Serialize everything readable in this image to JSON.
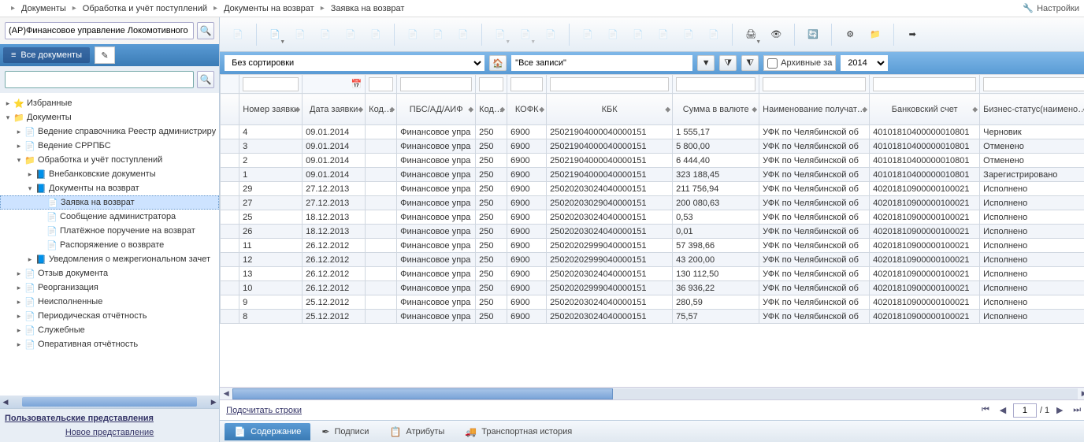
{
  "breadcrumb": {
    "items": [
      "Документы",
      "Обработка и учёт поступлений",
      "Документы на возврат",
      "Заявка на возврат"
    ]
  },
  "settings_label": "Настройки",
  "left": {
    "org_value": "(АР)Финансовое управление Локомотивного горо",
    "all_docs_tab": "Все документы",
    "tree": [
      {
        "d": 0,
        "t": "▸",
        "i": "⭐",
        "l": "Избранные"
      },
      {
        "d": 0,
        "t": "▾",
        "i": "📁",
        "l": "Документы"
      },
      {
        "d": 1,
        "t": "▸",
        "i": "📄",
        "l": "Ведение справочника Реестр администриру"
      },
      {
        "d": 1,
        "t": "▸",
        "i": "📄",
        "l": "Ведение СРРПБС"
      },
      {
        "d": 1,
        "t": "▾",
        "i": "📁",
        "l": "Обработка и учёт поступлений"
      },
      {
        "d": 2,
        "t": "▸",
        "i": "📘",
        "l": "Внебанковские документы"
      },
      {
        "d": 2,
        "t": "▾",
        "i": "📘",
        "l": "Документы на возврат"
      },
      {
        "d": 3,
        "t": "",
        "i": "📄",
        "l": "Заявка на возврат",
        "sel": true
      },
      {
        "d": 3,
        "t": "",
        "i": "📄",
        "l": "Сообщение администратора"
      },
      {
        "d": 3,
        "t": "",
        "i": "📄",
        "l": "Платёжное поручение на возврат"
      },
      {
        "d": 3,
        "t": "",
        "i": "📄",
        "l": "Распоряжение о возврате"
      },
      {
        "d": 2,
        "t": "▸",
        "i": "📘",
        "l": "Уведомления о межрегиональном зачет"
      },
      {
        "d": 1,
        "t": "▸",
        "i": "📄",
        "l": "Отзыв документа"
      },
      {
        "d": 1,
        "t": "▸",
        "i": "📄",
        "l": "Реорганизация"
      },
      {
        "d": 1,
        "t": "▸",
        "i": "📄",
        "l": "Неисполненные"
      },
      {
        "d": 1,
        "t": "▸",
        "i": "📄",
        "l": "Периодическая отчётность"
      },
      {
        "d": 1,
        "t": "▸",
        "i": "📄",
        "l": "Служебные"
      },
      {
        "d": 1,
        "t": "▸",
        "i": "📄",
        "l": "Оперативная отчётность"
      }
    ],
    "user_views_title": "Пользовательские представления",
    "new_view_link": "Новое представление"
  },
  "filterbar": {
    "sort_value": "Без сортировки",
    "records_value": "\"Все записи\"",
    "archive_label": "Архивные за",
    "archive_year": "2014"
  },
  "grid": {
    "columns": [
      {
        "k": "num",
        "label": "Номер заявки"
      },
      {
        "k": "date",
        "label": "Дата заявки"
      },
      {
        "k": "kod1",
        "label": "Код по Свод реест"
      },
      {
        "k": "pbs",
        "label": "ПБС/АД/АИФ"
      },
      {
        "k": "kod2",
        "label": "Код главы по БК"
      },
      {
        "k": "kofk",
        "label": "КОФК"
      },
      {
        "k": "kbk",
        "label": "КБК"
      },
      {
        "k": "sum",
        "label": "Сумма в валюте"
      },
      {
        "k": "recv",
        "label": "Наименование получателя"
      },
      {
        "k": "acc",
        "label": "Банковский счет"
      },
      {
        "k": "stat",
        "label": "Бизнес-статус(наименован"
      }
    ],
    "rows": [
      {
        "num": "4",
        "date": "09.01.2014",
        "kod1": "",
        "pbs": "Финансовое упра",
        "kod2": "250",
        "kofk": "6900",
        "kbk": "25021904000040000151",
        "sum": "1 555,17",
        "recv": "УФК по Челябинской об",
        "acc": "40101810400000010801",
        "stat": "Черновик"
      },
      {
        "num": "3",
        "date": "09.01.2014",
        "kod1": "",
        "pbs": "Финансовое упра",
        "kod2": "250",
        "kofk": "6900",
        "kbk": "25021904000040000151",
        "sum": "5 800,00",
        "recv": "УФК по Челябинской об",
        "acc": "40101810400000010801",
        "stat": "Отменено"
      },
      {
        "num": "2",
        "date": "09.01.2014",
        "kod1": "",
        "pbs": "Финансовое упра",
        "kod2": "250",
        "kofk": "6900",
        "kbk": "25021904000040000151",
        "sum": "6 444,40",
        "recv": "УФК по Челябинской об",
        "acc": "40101810400000010801",
        "stat": "Отменено"
      },
      {
        "num": "1",
        "date": "09.01.2014",
        "kod1": "",
        "pbs": "Финансовое упра",
        "kod2": "250",
        "kofk": "6900",
        "kbk": "25021904000040000151",
        "sum": "323 188,45",
        "recv": "УФК по Челябинской об",
        "acc": "40101810400000010801",
        "stat": "Зарегистрировано"
      },
      {
        "num": "29",
        "date": "27.12.2013",
        "kod1": "",
        "pbs": "Финансовое упра",
        "kod2": "250",
        "kofk": "6900",
        "kbk": "25020203024040000151",
        "sum": "211 756,94",
        "recv": "УФК по Челябинской об",
        "acc": "40201810900000100021",
        "stat": "Исполнено"
      },
      {
        "num": "27",
        "date": "27.12.2013",
        "kod1": "",
        "pbs": "Финансовое упра",
        "kod2": "250",
        "kofk": "6900",
        "kbk": "25020203029040000151",
        "sum": "200 080,63",
        "recv": "УФК по Челябинской об",
        "acc": "40201810900000100021",
        "stat": "Исполнено"
      },
      {
        "num": "25",
        "date": "18.12.2013",
        "kod1": "",
        "pbs": "Финансовое упра",
        "kod2": "250",
        "kofk": "6900",
        "kbk": "25020203024040000151",
        "sum": "0,53",
        "recv": "УФК по Челябинской об",
        "acc": "40201810900000100021",
        "stat": "Исполнено"
      },
      {
        "num": "26",
        "date": "18.12.2013",
        "kod1": "",
        "pbs": "Финансовое упра",
        "kod2": "250",
        "kofk": "6900",
        "kbk": "25020203024040000151",
        "sum": "0,01",
        "recv": "УФК по Челябинской об",
        "acc": "40201810900000100021",
        "stat": "Исполнено"
      },
      {
        "num": "11",
        "date": "26.12.2012",
        "kod1": "",
        "pbs": "Финансовое упра",
        "kod2": "250",
        "kofk": "6900",
        "kbk": "25020202999040000151",
        "sum": "57 398,66",
        "recv": "УФК по Челябинской об",
        "acc": "40201810900000100021",
        "stat": "Исполнено"
      },
      {
        "num": "12",
        "date": "26.12.2012",
        "kod1": "",
        "pbs": "Финансовое упра",
        "kod2": "250",
        "kofk": "6900",
        "kbk": "25020202999040000151",
        "sum": "43 200,00",
        "recv": "УФК по Челябинской об",
        "acc": "40201810900000100021",
        "stat": "Исполнено"
      },
      {
        "num": "13",
        "date": "26.12.2012",
        "kod1": "",
        "pbs": "Финансовое упра",
        "kod2": "250",
        "kofk": "6900",
        "kbk": "25020203024040000151",
        "sum": "130 112,50",
        "recv": "УФК по Челябинской об",
        "acc": "40201810900000100021",
        "stat": "Исполнено"
      },
      {
        "num": "10",
        "date": "26.12.2012",
        "kod1": "",
        "pbs": "Финансовое упра",
        "kod2": "250",
        "kofk": "6900",
        "kbk": "25020202999040000151",
        "sum": "36 936,22",
        "recv": "УФК по Челябинской об",
        "acc": "40201810900000100021",
        "stat": "Исполнено"
      },
      {
        "num": "9",
        "date": "25.12.2012",
        "kod1": "",
        "pbs": "Финансовое упра",
        "kod2": "250",
        "kofk": "6900",
        "kbk": "25020203024040000151",
        "sum": "280,59",
        "recv": "УФК по Челябинской об",
        "acc": "40201810900000100021",
        "stat": "Исполнено"
      },
      {
        "num": "8",
        "date": "25.12.2012",
        "kod1": "",
        "pbs": "Финансовое упра",
        "kod2": "250",
        "kofk": "6900",
        "kbk": "25020203024040000151",
        "sum": "75,57",
        "recv": "УФК по Челябинской об",
        "acc": "40201810900000100021",
        "stat": "Исполнено"
      }
    ],
    "count_link": "Подсчитать строки",
    "page": "1",
    "page_total": "/ 1"
  },
  "bottom_tabs": {
    "content": "Содержание",
    "signatures": "Подписи",
    "attributes": "Атрибуты",
    "transport": "Транспортная история"
  }
}
